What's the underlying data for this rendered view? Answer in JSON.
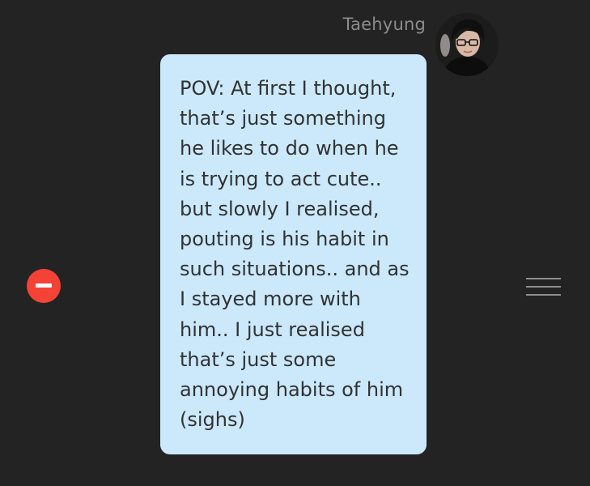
{
  "message": {
    "sender_name": "Taehyung",
    "text": "POV: At first I thought, that’s just something he likes to do when he is trying to act cute.. but slowly I realised, pouting is his habit in such situations.. and as I stayed more with him.. I just realised that’s just some annoying habits of him (sighs)",
    "bubble_color": "#cbe9fb"
  },
  "controls": {
    "delete_icon": "minus-circle-icon",
    "delete_color": "#f44336",
    "drag_icon": "hamburger-icon"
  },
  "theme": {
    "background": "#232323"
  }
}
